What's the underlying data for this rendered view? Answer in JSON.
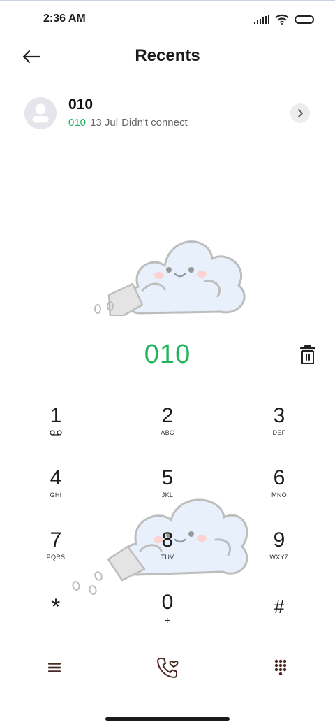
{
  "status_bar": {
    "time": "2:36 AM",
    "icons": [
      "signal-icon",
      "wifi-icon",
      "battery-icon"
    ]
  },
  "header": {
    "title": "Recents",
    "back_icon": "arrow-left-icon"
  },
  "recent_call": {
    "name": "010",
    "number": "010",
    "date": "13 Jul",
    "status": "Didn't connect",
    "avatar_icon": "person-icon",
    "detail_icon": "chevron-right-icon"
  },
  "dialer": {
    "input_value": "010",
    "delete_icon": "trash-icon",
    "keys": [
      {
        "digit": "1",
        "letters": "",
        "icon": "voicemail-icon"
      },
      {
        "digit": "2",
        "letters": "ABC"
      },
      {
        "digit": "3",
        "letters": "DEF"
      },
      {
        "digit": "4",
        "letters": "GHI"
      },
      {
        "digit": "5",
        "letters": "JKL"
      },
      {
        "digit": "6",
        "letters": "MNO"
      },
      {
        "digit": "7",
        "letters": "PQRS"
      },
      {
        "digit": "8",
        "letters": "TUV"
      },
      {
        "digit": "9",
        "letters": "WXYZ"
      },
      {
        "digit": "*",
        "letters": ""
      },
      {
        "digit": "0",
        "letters": "+"
      },
      {
        "digit": "#",
        "letters": ""
      }
    ]
  },
  "bottom_bar": {
    "menu_icon": "hamburger-menu-icon",
    "call_icon": "phone-heart-icon",
    "keypad_icon": "keypad-grid-icon"
  },
  "colors": {
    "accent_green": "#22b35d",
    "bottom_icon": "#4a2a22",
    "cloud_fill": "#e8f1fb",
    "cloud_stroke": "#bdbdbd"
  }
}
